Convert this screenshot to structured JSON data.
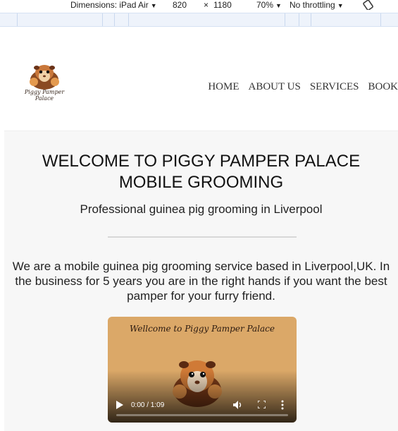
{
  "devtools": {
    "dimensions_label": "Dimensions: iPad Air",
    "width": "820",
    "times": "×",
    "height": "1180",
    "zoom": "70%",
    "throttling": "No throttling"
  },
  "site": {
    "logo_text": "Piggy Pamper Palace",
    "nav": [
      "HOME",
      "ABOUT US",
      "SERVICES",
      "BOOK"
    ],
    "hero": {
      "title": "WELCOME TO PIGGY PAMPER PALACE MOBILE GROOMING",
      "subtitle": "Professional guinea pig grooming in Liverpool",
      "intro": "We are a mobile guinea pig grooming service based in Liverpool,UK. In the business for 5 years you are in the right hands if you want the best pamper for your furry friend."
    },
    "video": {
      "overlay_title": "Wellcome to Piggy Pamper Palace",
      "time": "0:00 / 1:09",
      "progress": 0.0
    }
  },
  "colors": {
    "video_bg": "#dba868",
    "page_bg": "#f7f7f7",
    "header_bg": "#ffffff"
  },
  "icons": [
    "chevron-down-icon",
    "rotate-icon",
    "play-icon",
    "volume-icon",
    "fullscreen-icon",
    "more-vert-icon"
  ]
}
